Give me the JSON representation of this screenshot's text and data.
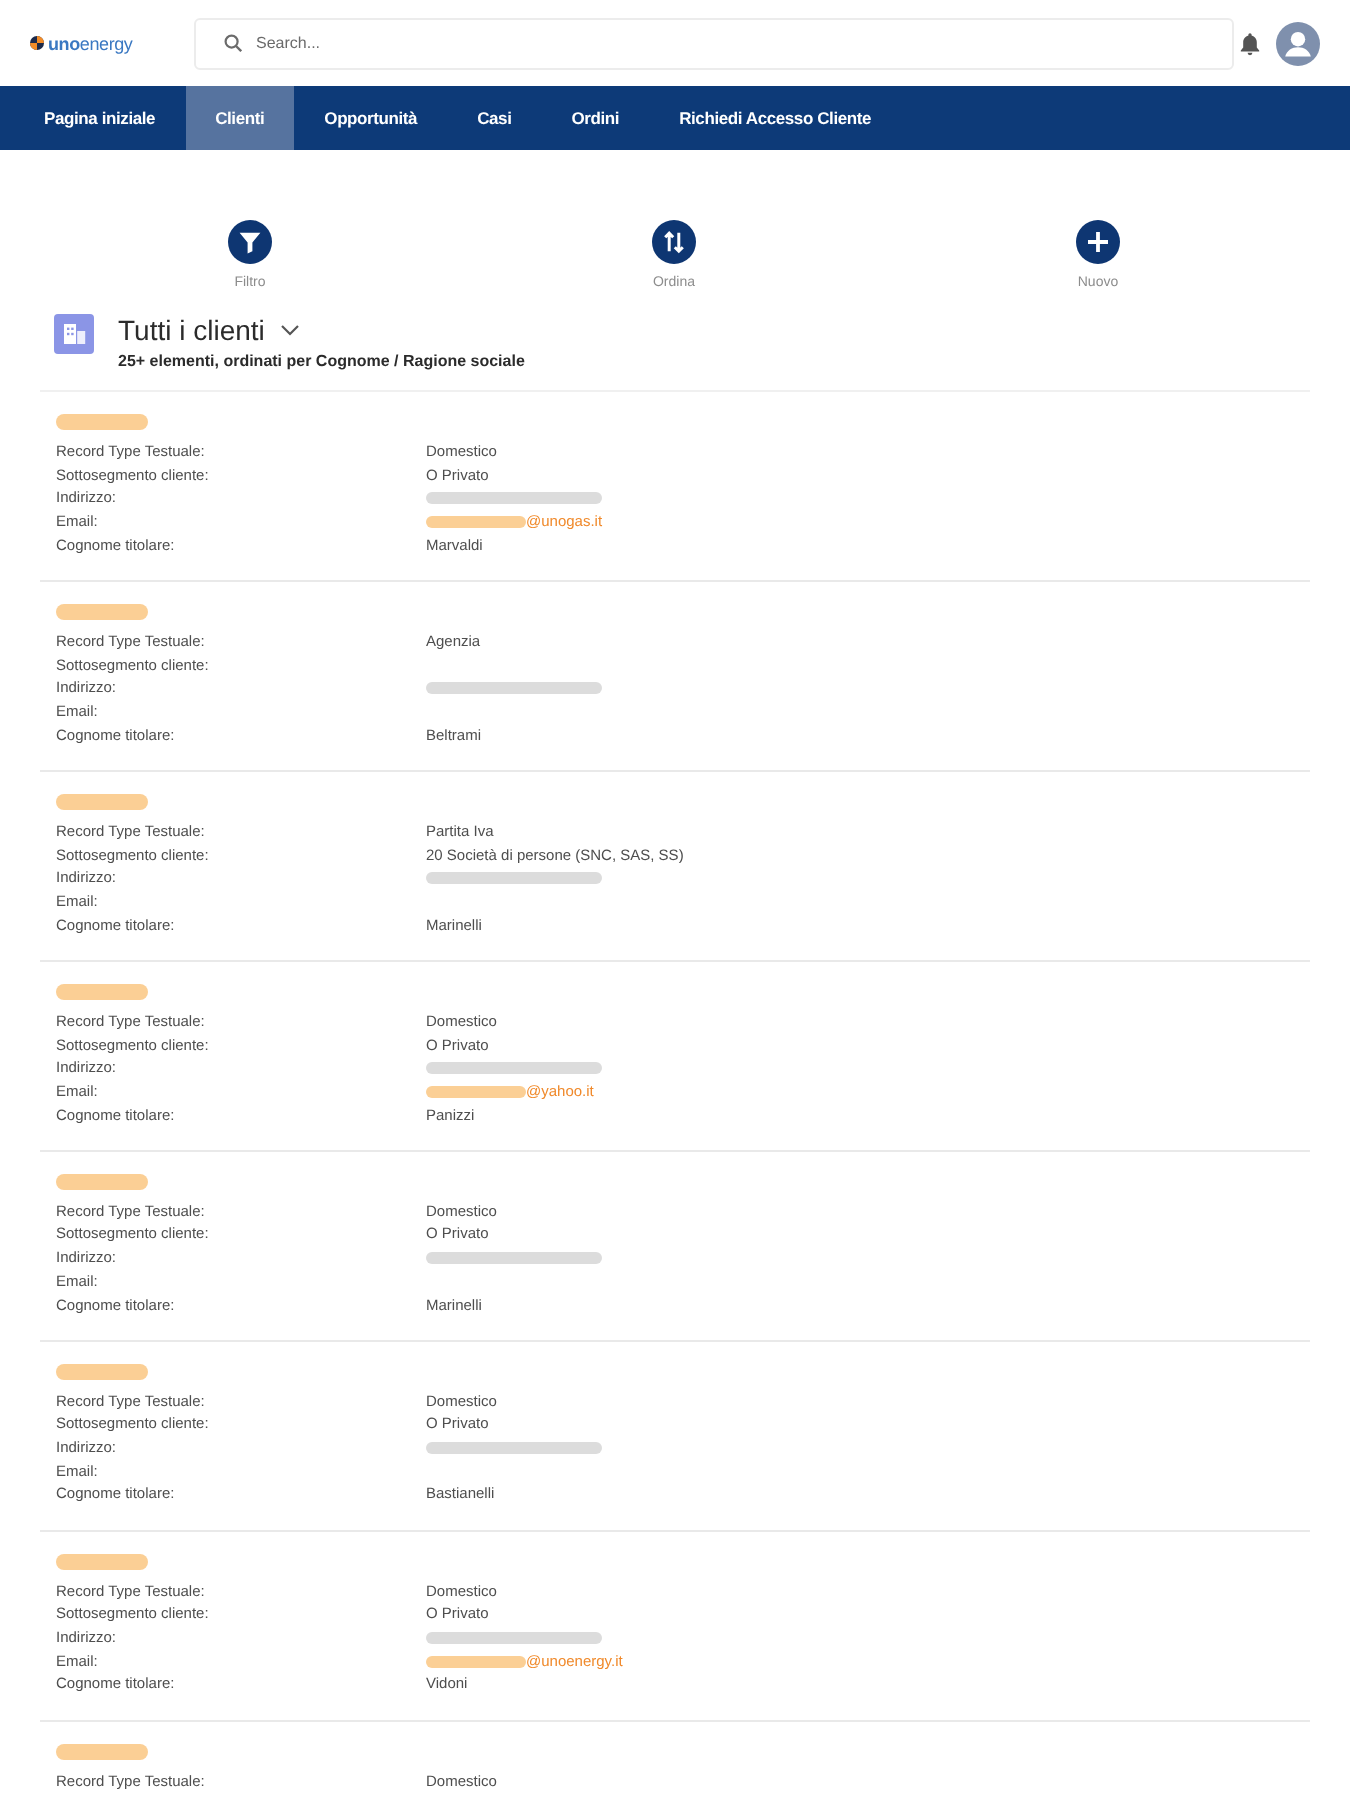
{
  "header": {
    "logo": "**uno**energy",
    "search": {
      "placeholder": "Search..."
    }
  },
  "nav": [
    {
      "label": "Pagina iniziale",
      "selected": false
    },
    {
      "label": "Clienti",
      "selected": true
    },
    {
      "label": "Opportunità",
      "selected": false
    },
    {
      "label": "Casi",
      "selected": false
    },
    {
      "label": "Ordini",
      "selected": false
    },
    {
      "label": "Richiedi Accesso Cliente",
      "selected": false
    }
  ],
  "actions": [
    {
      "kind": "filter",
      "label": "Filtro"
    },
    {
      "kind": "sort",
      "label": "Ordina"
    },
    {
      "kind": "new",
      "label": "Nuovo"
    }
  ],
  "list_view": {
    "title": "Tutti i clienti",
    "subtitle": "25+ elementi, ordinati per Cognome / Ragione sociale"
  },
  "records": [
    {
      "name_blurred": true,
      "fields": [
        {
          "label": "Record Type Testuale:",
          "kind": "text",
          "value": "Domestico"
        },
        {
          "label": "Sottosegmento cliente:",
          "kind": "text",
          "value": "O Privato"
        },
        {
          "label": "Indirizzo:",
          "kind": "blurred"
        },
        {
          "label": "Email:",
          "kind": "email",
          "value": "@unogas.it"
        },
        {
          "label": "Cognome titolare:",
          "kind": "text",
          "value": "Marvaldi"
        }
      ]
    },
    {
      "name_blurred": true,
      "fields": [
        {
          "label": "Record Type Testuale:",
          "kind": "text",
          "value": "Agenzia"
        },
        {
          "label": "Sottosegmento cliente:",
          "kind": "empty"
        },
        {
          "label": "Indirizzo:",
          "kind": "blurred"
        },
        {
          "label": "Email:",
          "kind": "empty"
        },
        {
          "label": "Cognome titolare:",
          "kind": "text",
          "value": "Beltrami"
        }
      ]
    },
    {
      "name_blurred": true,
      "fields": [
        {
          "label": "Record Type Testuale:",
          "kind": "text",
          "value": "Partita Iva"
        },
        {
          "label": "Sottosegmento cliente:",
          "kind": "text",
          "value": "20 Società di persone (SNC, SAS, SS)"
        },
        {
          "label": "Indirizzo:",
          "kind": "blurred"
        },
        {
          "label": "Email:",
          "kind": "empty"
        },
        {
          "label": "Cognome titolare:",
          "kind": "text",
          "value": "Marinelli"
        }
      ]
    },
    {
      "name_blurred": true,
      "fields": [
        {
          "label": "Record Type Testuale:",
          "kind": "text",
          "value": "Domestico"
        },
        {
          "label": "Sottosegmento cliente:",
          "kind": "text",
          "value": "O Privato"
        },
        {
          "label": "Indirizzo:",
          "kind": "blurred"
        },
        {
          "label": "Email:",
          "kind": "email",
          "value": "@yahoo.it"
        },
        {
          "label": "Cognome titolare:",
          "kind": "text",
          "value": "Panizzi"
        }
      ]
    },
    {
      "name_blurred": true,
      "fields": [
        {
          "label": "Record Type Testuale:",
          "kind": "text",
          "value": "Domestico"
        },
        {
          "label": "Sottosegmento cliente:",
          "kind": "text",
          "value": "O Privato"
        },
        {
          "label": "Indirizzo:",
          "kind": "blurred"
        },
        {
          "label": "Email:",
          "kind": "empty"
        },
        {
          "label": "Cognome titolare:",
          "kind": "text",
          "value": "Marinelli"
        }
      ]
    },
    {
      "name_blurred": true,
      "fields": [
        {
          "label": "Record Type Testuale:",
          "kind": "text",
          "value": "Domestico"
        },
        {
          "label": "Sottosegmento cliente:",
          "kind": "text",
          "value": "O Privato"
        },
        {
          "label": "Indirizzo:",
          "kind": "blurred"
        },
        {
          "label": "Email:",
          "kind": "empty"
        },
        {
          "label": "Cognome titolare:",
          "kind": "text",
          "value": "Bastianelli"
        }
      ]
    },
    {
      "name_blurred": true,
      "fields": [
        {
          "label": "Record Type Testuale:",
          "kind": "text",
          "value": "Domestico"
        },
        {
          "label": "Sottosegmento cliente:",
          "kind": "text",
          "value": "O Privato"
        },
        {
          "label": "Indirizzo:",
          "kind": "blurred"
        },
        {
          "label": "Email:",
          "kind": "email",
          "value": "@unoenergy.it"
        },
        {
          "label": "Cognome titolare:",
          "kind": "text",
          "value": "Vidoni"
        }
      ]
    },
    {
      "name_blurred": true,
      "fields": [
        {
          "label": "Record Type Testuale:",
          "kind": "text",
          "value": "Domestico"
        }
      ]
    }
  ]
}
